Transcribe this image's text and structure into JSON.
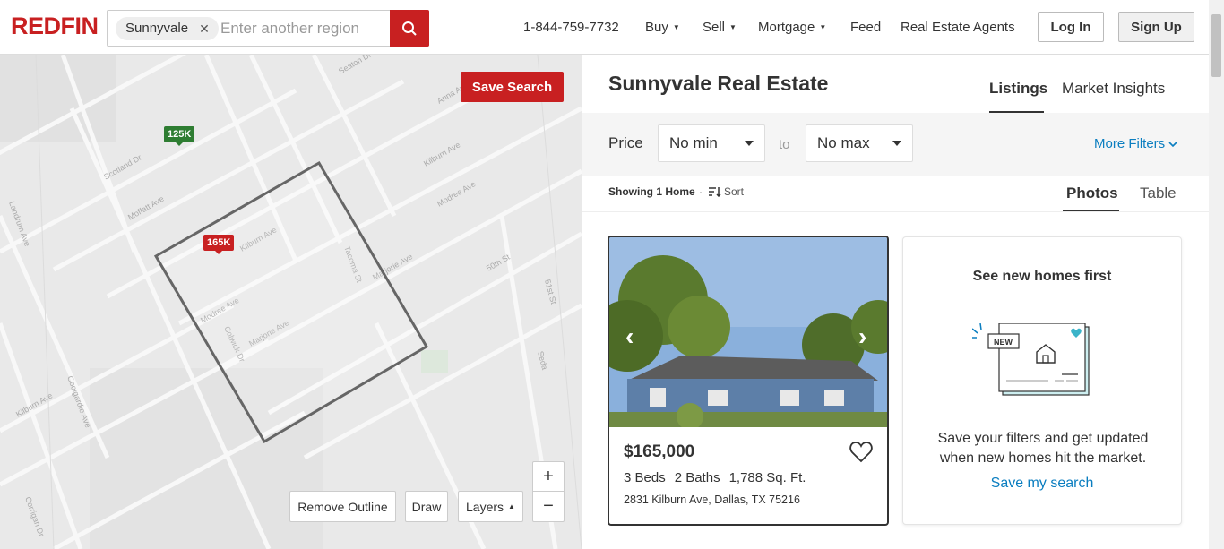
{
  "header": {
    "logo": "REDFIN",
    "search_chip": "Sunnyvale",
    "search_placeholder": "Enter another region",
    "phone": "1-844-759-7732",
    "nav": [
      "Buy",
      "Sell",
      "Mortgage",
      "Feed",
      "Real Estate Agents"
    ],
    "login": "Log In",
    "signup": "Sign Up"
  },
  "map": {
    "save_search": "Save Search",
    "pins": [
      "125K",
      "165K"
    ],
    "remove_outline": "Remove Outline",
    "draw": "Draw",
    "layers": "Layers",
    "zoom_in": "+",
    "zoom_out": "−",
    "street_labels": [
      "Seaton Dr",
      "Anna Ave",
      "Scotland Dr",
      "Moffatt Ave",
      "Kilburn Ave",
      "Modree Ave",
      "Kilburn Ave",
      "Tacoma St",
      "Marjorie Ave",
      "50th St",
      "Modree Ave",
      "Colwick Dr",
      "Marjorie Ave",
      "Kilburn Ave",
      "Landrum Ave",
      "Coolgardie Ave",
      "Corrigan Dr",
      "51st St",
      "Seda"
    ]
  },
  "panel": {
    "title": "Sunnyvale Real Estate",
    "tabs": [
      "Listings",
      "Market Insights"
    ],
    "price_label": "Price",
    "min_select": "No min",
    "to": "to",
    "max_select": "No max",
    "more_filters": "More Filters",
    "showing": "Showing 1 Home",
    "sort": "Sort",
    "view_tabs": [
      "Photos",
      "Table"
    ]
  },
  "listing": {
    "price": "$165,000",
    "beds": "3 Beds",
    "baths": "2 Baths",
    "sqft": "1,788 Sq. Ft.",
    "address": "2831 Kilburn Ave, Dallas, TX 75216"
  },
  "promo": {
    "title": "See new homes first",
    "badge": "NEW",
    "text": "Save your filters and get updated when new homes hit the market.",
    "link": "Save my search"
  },
  "colors": {
    "brand": "#c82021",
    "link": "#0b7ec0",
    "pin_green": "#2e7d32"
  }
}
